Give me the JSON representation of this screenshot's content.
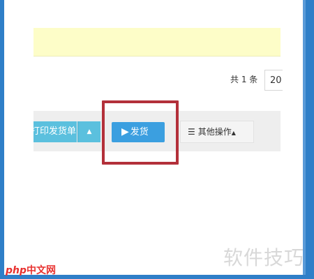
{
  "pager": {
    "total_label": "共 1 条",
    "page_size": "20"
  },
  "toolbar": {
    "print_label": "打印发货单",
    "print_caret": "▲",
    "ship_icon": "play-icon",
    "ship_label": "发货",
    "more_icon": "list-icon",
    "more_label": "其他操作",
    "more_caret": "▲"
  },
  "colors": {
    "frame": "#2f7fc8",
    "notice": "#fdfdc8",
    "print_button": "#5bc0de",
    "ship_button": "#3b9fe0",
    "highlight": "#b3303a"
  },
  "watermark": {
    "right": "软件技巧",
    "left_php": "php",
    "left_cn": "中文网"
  }
}
